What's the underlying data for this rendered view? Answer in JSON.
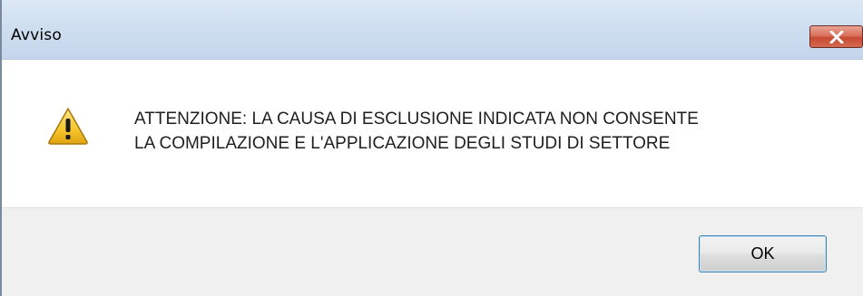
{
  "dialog": {
    "title": "Avviso",
    "close_icon": "close-icon",
    "icon": "warning-icon",
    "message_line1": "ATTENZIONE: LA CAUSA DI ESCLUSIONE INDICATA NON CONSENTE",
    "message_line2": "LA COMPILAZIONE E L'APPLICAZIONE DEGLI STUDI DI SETTORE",
    "ok_label": "OK"
  },
  "colors": {
    "titlebar": "#cfdff0",
    "close_button": "#c74a33",
    "warning_fill": "#f5c52b",
    "footer": "#f0f0f0",
    "ok_border": "#3c7fb1"
  }
}
